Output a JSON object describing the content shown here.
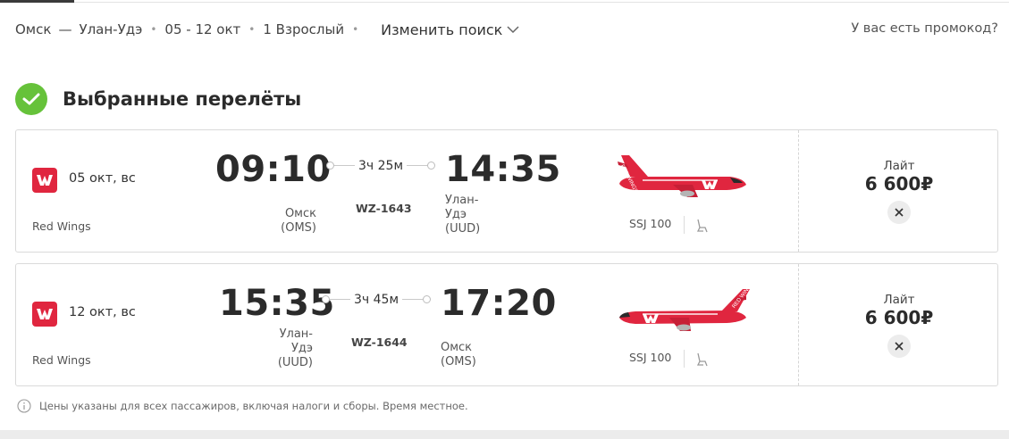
{
  "summary": {
    "origin": "Омск",
    "dash": "—",
    "destination": "Улан-Удэ",
    "dates": "05 - 12 окт",
    "passengers": "1 Взрослый",
    "change_label": "Изменить поиск",
    "promo_label": "У вас есть промокод?"
  },
  "section": {
    "title": "Выбранные перелёты"
  },
  "flights": [
    {
      "date": "05 окт, вс",
      "airline": "Red Wings",
      "dep_time": "09:10",
      "dep_airport_line1": "Омск",
      "dep_airport_line2": "(OMS)",
      "duration": "3ч 25м",
      "flight_number": "WZ-1643",
      "arr_time": "14:35",
      "arr_airport_line1": "Улан-",
      "arr_airport_line2": "Удэ",
      "arr_airport_line3": "(UUD)",
      "aircraft": "SSJ 100",
      "fare": "Лайт",
      "price": "6 600₽"
    },
    {
      "date": "12 окт, вс",
      "airline": "Red Wings",
      "dep_time": "15:35",
      "dep_airport_line1": "Улан-",
      "dep_airport_line2": "Удэ",
      "dep_airport_line3": "(UUD)",
      "duration": "3ч 45м",
      "flight_number": "WZ-1644",
      "arr_time": "17:20",
      "arr_airport_line1": "Омск",
      "arr_airport_line2": "(OMS)",
      "aircraft": "SSJ 100",
      "fare": "Лайт",
      "price": "6 600₽"
    }
  ],
  "note": "Цены указаны для всех пассажиров, включая налоги и сборы. Время местное.",
  "colors": {
    "brand_red": "#e0263f",
    "check_green": "#66c23a"
  },
  "icons": {
    "check": "check-icon",
    "chevron": "chevron-down-icon",
    "remove": "close-icon",
    "seat": "seat-icon",
    "info": "info-icon"
  }
}
